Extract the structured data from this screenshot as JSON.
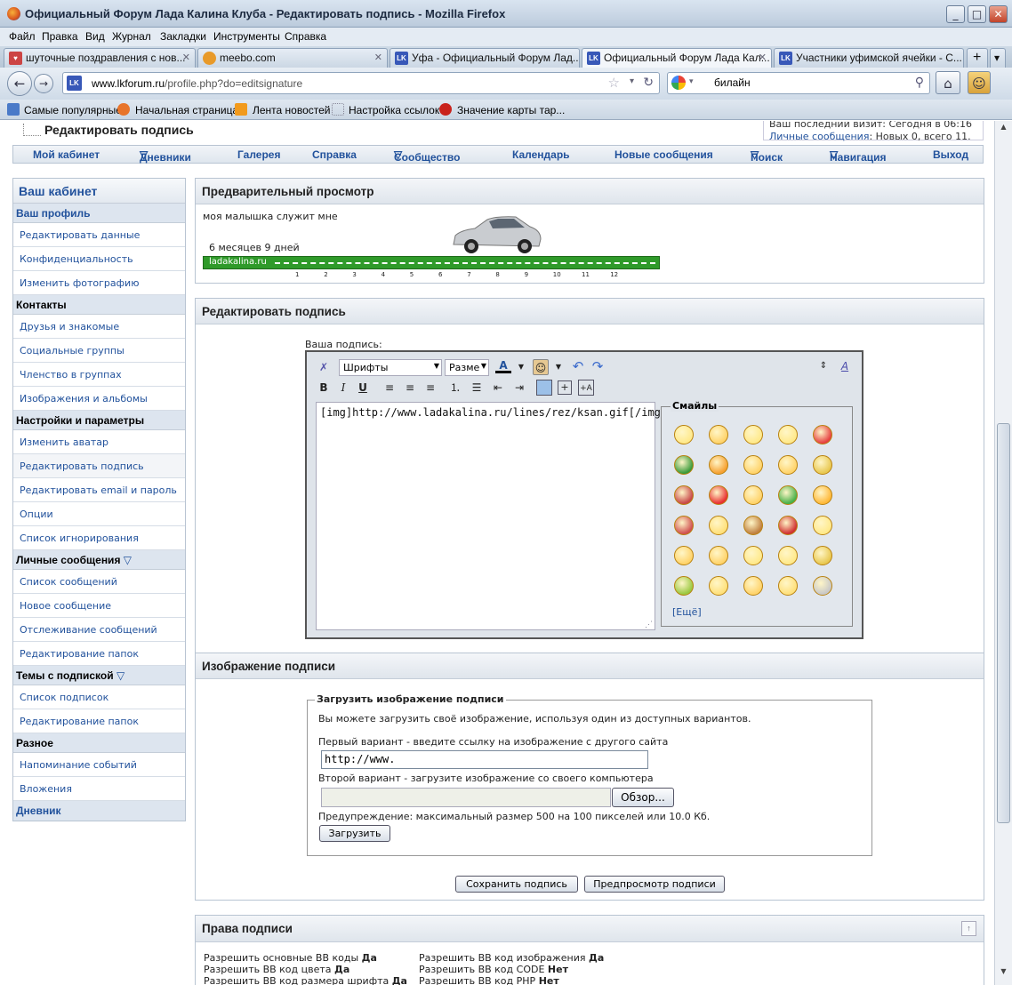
{
  "window": {
    "title": "Официальный Форум Лада Калина Клуба - Редактировать подпись - Mozilla Firefox"
  },
  "menu": [
    "Файл",
    "Правка",
    "Вид",
    "Журнал",
    "Закладки",
    "Инструменты",
    "Справка"
  ],
  "tabs": [
    {
      "label": "шуточные поздравления с нов...",
      "active": false
    },
    {
      "label": "meebo.com",
      "active": false
    },
    {
      "label": "Уфа - Официальный Форум Лад...",
      "active": false
    },
    {
      "label": "Официальный Форум Лада Кал...",
      "active": true
    },
    {
      "label": "Участники уфимской ячейки - С...",
      "active": false
    }
  ],
  "address": {
    "host": "www.lkforum.ru",
    "path": "/profile.php?do=editsignature"
  },
  "search": {
    "value": "билайн"
  },
  "bookmarks": [
    "Самые популярные",
    "Начальная страница",
    "Лента новостей",
    "Настройка ссылок",
    "Значение карты тар..."
  ],
  "page": {
    "breadcrumb": "Редактировать подпись",
    "last_visit": "Ваш последний визит: Сегодня в 06:16",
    "pm_link": "Личные сообщения",
    "pm_text": ": Новых 0, всего 11."
  },
  "topnav": [
    "Мой кабинет",
    "Дневники",
    "Галерея",
    "Справка",
    "Сообщество",
    "Календарь",
    "Новые сообщения",
    "Поиск",
    "Навигация",
    "Выход"
  ],
  "sidebar": {
    "title": "Ваш кабинет",
    "sections": [
      {
        "label": "Ваш профиль",
        "blue": true,
        "items": [
          "Редактировать данные",
          "Конфиденциальность",
          "Изменить фотографию"
        ]
      },
      {
        "label": "Контакты",
        "blue": false,
        "items": [
          "Друзья и знакомые",
          "Социальные группы",
          "Членство в группах",
          "Изображения и альбомы"
        ]
      },
      {
        "label": "Настройки и параметры",
        "blue": false,
        "items": [
          "Изменить аватар",
          "Редактировать подпись",
          "Редактировать email и пароль",
          "Опции",
          "Список игнорирования"
        ]
      },
      {
        "label": "Личные сообщения",
        "blue": false,
        "items": [
          "Список сообщений",
          "Новое сообщение",
          "Отслеживание сообщений",
          "Редактирование папок"
        ]
      },
      {
        "label": "Темы с подпиской",
        "blue": false,
        "items": [
          "Список подписок",
          "Редактирование папок"
        ]
      },
      {
        "label": "Разное",
        "blue": false,
        "items": [
          "Напоминание событий",
          "Вложения"
        ]
      },
      {
        "label": "Дневник",
        "blue": true,
        "items": []
      }
    ]
  },
  "preview": {
    "title": "Предварительный просмотр",
    "line1": "моя малышка служит мне",
    "line2": "6 месяцев 9 дней",
    "site": "ladakalina.ru",
    "months": [
      "1",
      "2",
      "3",
      "4",
      "5",
      "6",
      "7",
      "8",
      "9",
      "10",
      "11",
      "12"
    ]
  },
  "editor": {
    "title": "Редактировать подпись",
    "label": "Ваша подпись:",
    "font_select": "Шрифты",
    "size_select": "Разме",
    "text": "[img]http://www.ladakalina.ru/lines/rez/ksan.gif[/img]",
    "smilies_title": "Смайлы",
    "more": "[Ещё]"
  },
  "image": {
    "title": "Изображение подписи",
    "fieldset": "Загрузить изображение подписи",
    "desc": "Вы можете загрузить своё изображение, используя один из доступных вариантов.",
    "opt1": "Первый вариант - введите ссылку на изображение с другого сайта",
    "url_value": "http://www.",
    "opt2": "Второй вариант - загрузите изображение со своего компьютера",
    "browse": "Обзор...",
    "warning": "Предупреждение: максимальный размер 500 на 100 пикселей или 10.0 Кб.",
    "upload": "Загрузить"
  },
  "actions": {
    "save": "Сохранить подпись",
    "preview": "Предпросмотр подписи"
  },
  "rights": {
    "title": "Права подписи",
    "col1": [
      [
        "Разрешить основные BB коды ",
        "Да"
      ],
      [
        "Разрешить BB код цвета ",
        "Да"
      ],
      [
        "Разрешить BB код размера шрифта ",
        "Да"
      ]
    ],
    "col2": [
      [
        "Разрешить BB код изображения ",
        "Да"
      ],
      [
        "Разрешить BB код CODE ",
        "Нет"
      ],
      [
        "Разрешить BB код PHP ",
        "Нет"
      ]
    ]
  }
}
